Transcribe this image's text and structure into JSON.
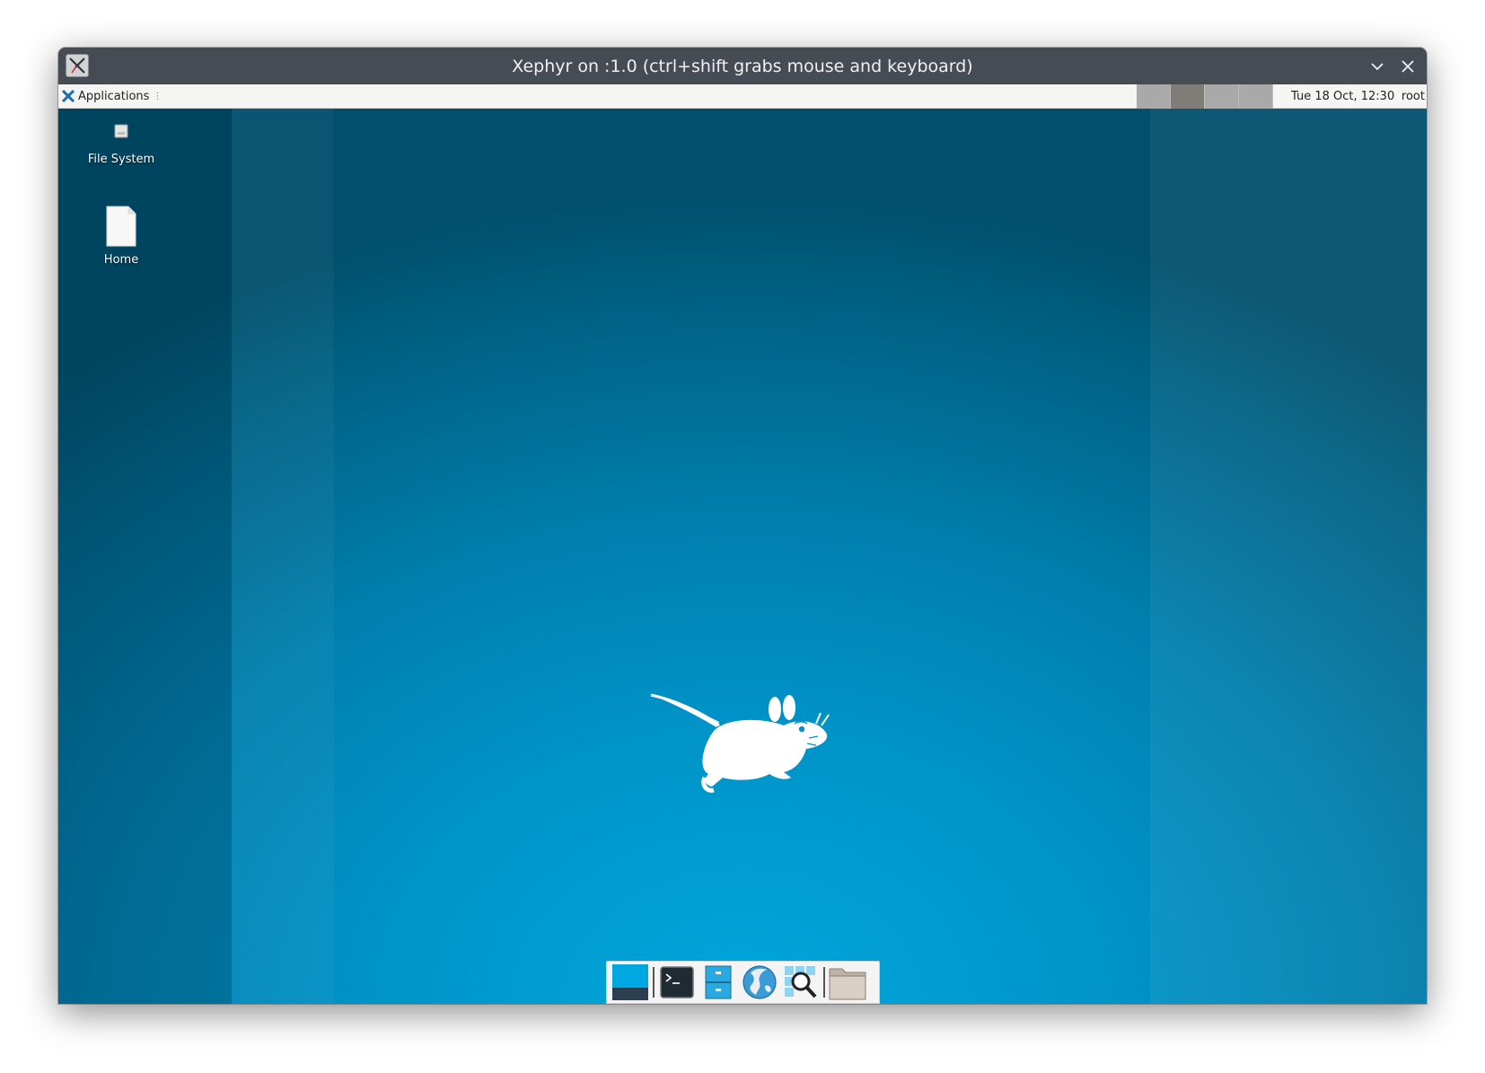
{
  "window": {
    "title": "Xephyr on :1.0 (ctrl+shift grabs mouse and keyboard)",
    "app_icon": "x11-icon",
    "controls": {
      "minimize": "chevron-down-icon",
      "close": "close-icon"
    }
  },
  "panel": {
    "apps_menu_label": "Applications",
    "apps_menu_icon": "xfce-mouse-icon",
    "apps_menu_indicator": "⋮",
    "workspaces": [
      {
        "id": "1",
        "active": false,
        "color": "#a9a9a9"
      },
      {
        "id": "2",
        "active": true,
        "color": "#807c78"
      },
      {
        "id": "3",
        "active": false,
        "color": "#a9a9a9"
      },
      {
        "id": "4",
        "active": false,
        "color": "#a9a9a9"
      }
    ],
    "clock": "Tue 18 Oct, 12:30",
    "user": "root"
  },
  "desktop": {
    "icons": [
      {
        "label": "File System",
        "icon": "drive-icon"
      },
      {
        "label": "Home",
        "icon": "document-icon"
      }
    ],
    "wallpaper_colors": {
      "center": "#00a7dc",
      "edge": "#00506d"
    },
    "mascot": "xfce-mouse-mascot"
  },
  "dock": {
    "items": [
      {
        "name": "show-desktop",
        "icon": "desktop-icon"
      },
      {
        "name": "terminal",
        "icon": "terminal-icon"
      },
      {
        "name": "file-manager",
        "icon": "file-cabinet-icon"
      },
      {
        "name": "web-browser",
        "icon": "globe-icon"
      },
      {
        "name": "app-finder",
        "icon": "magnifier-icon"
      },
      {
        "name": "folder",
        "icon": "folder-icon"
      }
    ]
  }
}
